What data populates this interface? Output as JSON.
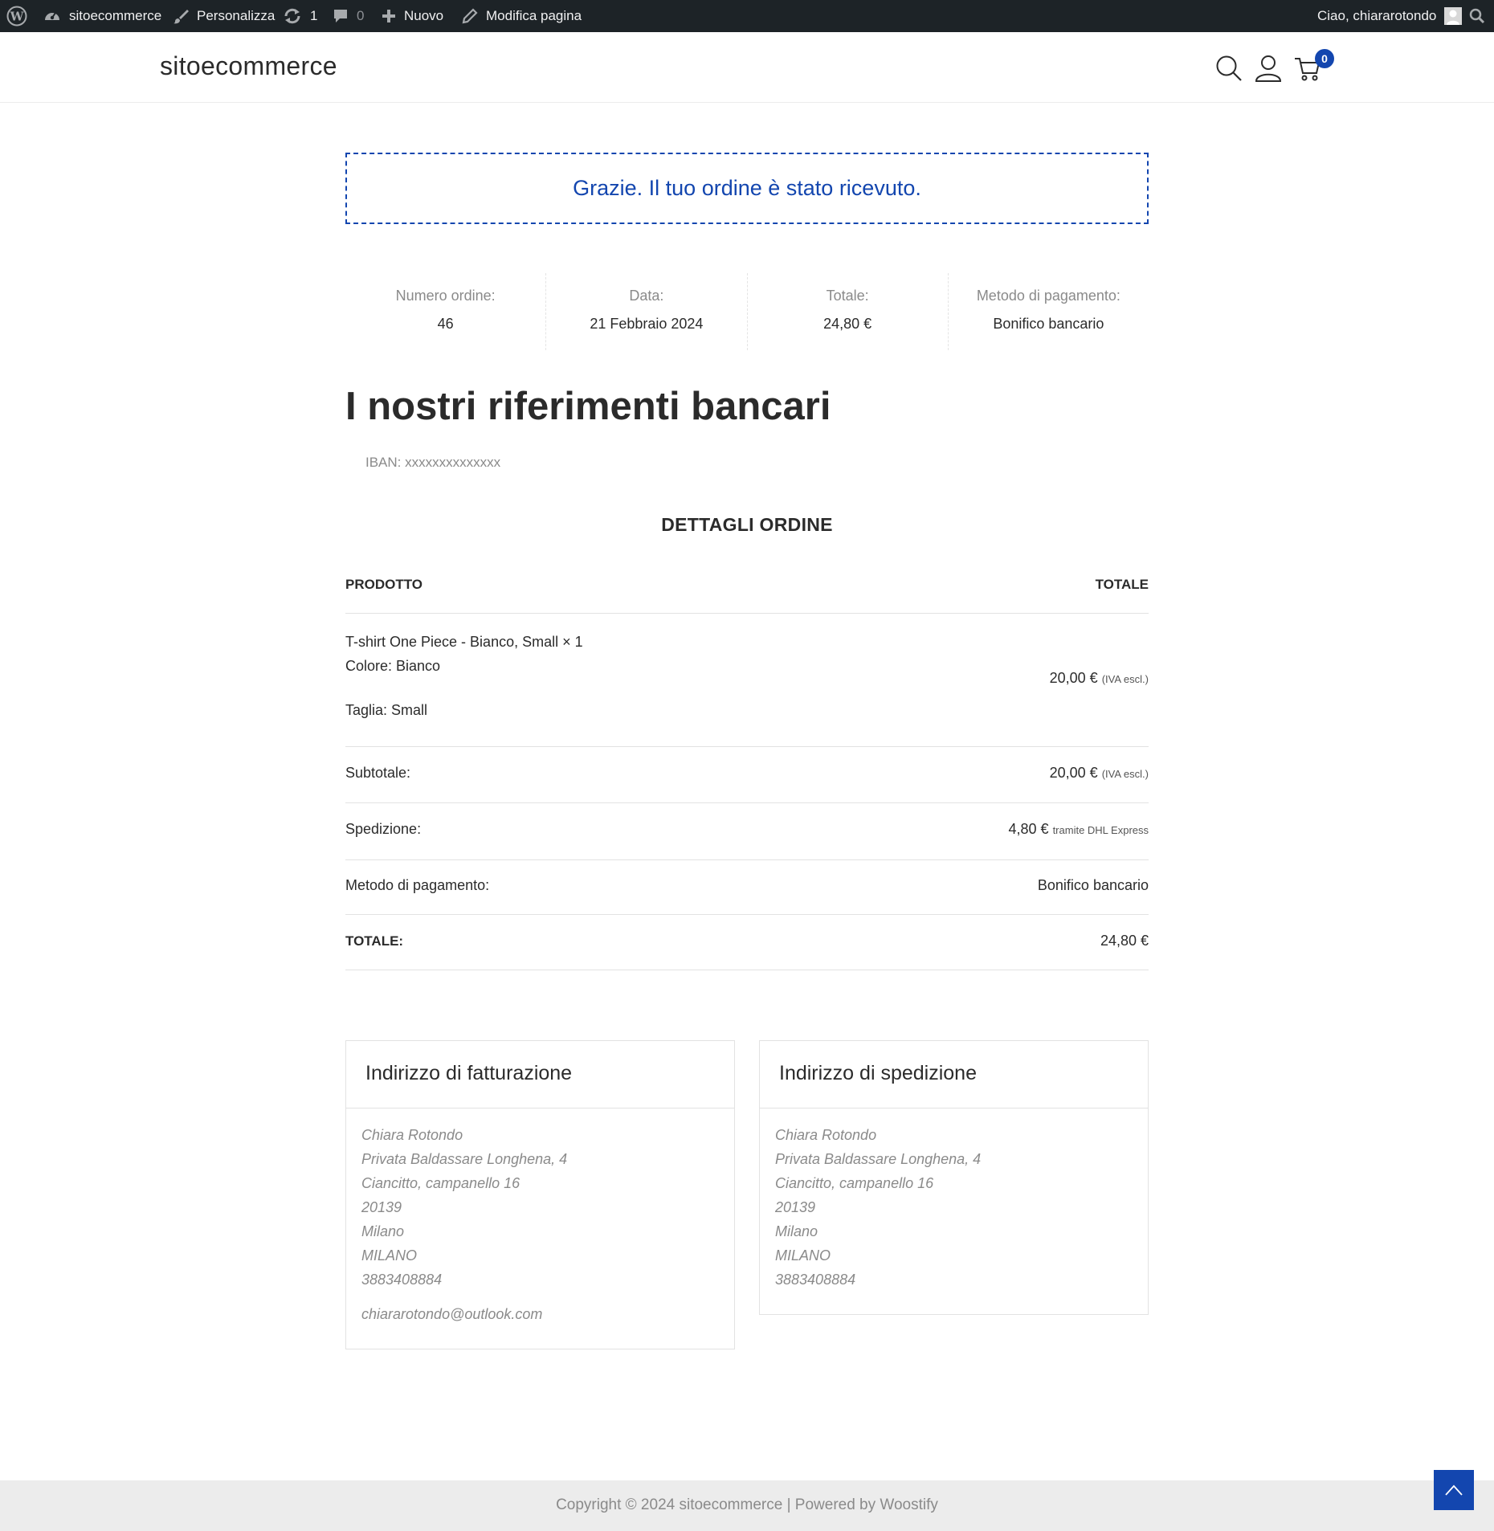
{
  "admin_bar": {
    "site_name": "sitoecommerce",
    "customize": "Personalizza",
    "updates_count": "1",
    "comments_count": "0",
    "new": "Nuovo",
    "edit_page": "Modifica pagina",
    "greeting": "Ciao, chiararotondo"
  },
  "header": {
    "site_title": "sitoecommerce",
    "cart_count": "0"
  },
  "notice": "Grazie. Il tuo ordine è stato ricevuto.",
  "overview": [
    {
      "label": "Numero ordine:",
      "value": "46"
    },
    {
      "label": "Data:",
      "value": "21 Febbraio 2024"
    },
    {
      "label": "Totale:",
      "value": "24,80 €"
    },
    {
      "label": "Metodo di pagamento:",
      "value": "Bonifico bancario"
    }
  ],
  "bank": {
    "title": "I nostri riferimenti bancari",
    "iban_label": "IBAN:",
    "iban_value": "xxxxxxxxxxxxxx"
  },
  "order_details": {
    "title": "DETTAGLI ORDINE",
    "col_product": "PRODOTTO",
    "col_total": "TOTALE",
    "item": {
      "name": "T-shirt One Piece - Bianco, Small",
      "qty": "× 1",
      "color": "Colore: Bianco",
      "size": "Taglia: Small",
      "price": "20,00 €",
      "tax_note": "(IVA escl.)"
    },
    "subtotal_label": "Subtotale:",
    "subtotal_value": "20,00 €",
    "subtotal_note": "(IVA escl.)",
    "shipping_label": "Spedizione:",
    "shipping_value": "4,80 €",
    "shipping_note": "tramite DHL Express",
    "payment_label": "Metodo di pagamento:",
    "payment_value": "Bonifico bancario",
    "total_label": "TOTALE:",
    "total_value": "24,80 €"
  },
  "billing": {
    "title": "Indirizzo di fatturazione",
    "lines": [
      "Chiara Rotondo",
      "Privata Baldassare Longhena, 4",
      "Ciancitto, campanello 16",
      "20139",
      "Milano",
      "MILANO",
      "3883408884"
    ],
    "email": "chiararotondo@outlook.com"
  },
  "shipping": {
    "title": "Indirizzo di spedizione",
    "lines": [
      "Chiara Rotondo",
      "Privata Baldassare Longhena, 4",
      "Ciancitto, campanello 16",
      "20139",
      "Milano",
      "MILANO",
      "3883408884"
    ]
  },
  "footer": {
    "copyright": "Copyright © 2024 sitoecommerce | Powered by Woostify"
  },
  "colors": {
    "accent": "#1346af",
    "admin_bar": "#1d2327",
    "muted_text": "#8a8a8a"
  }
}
